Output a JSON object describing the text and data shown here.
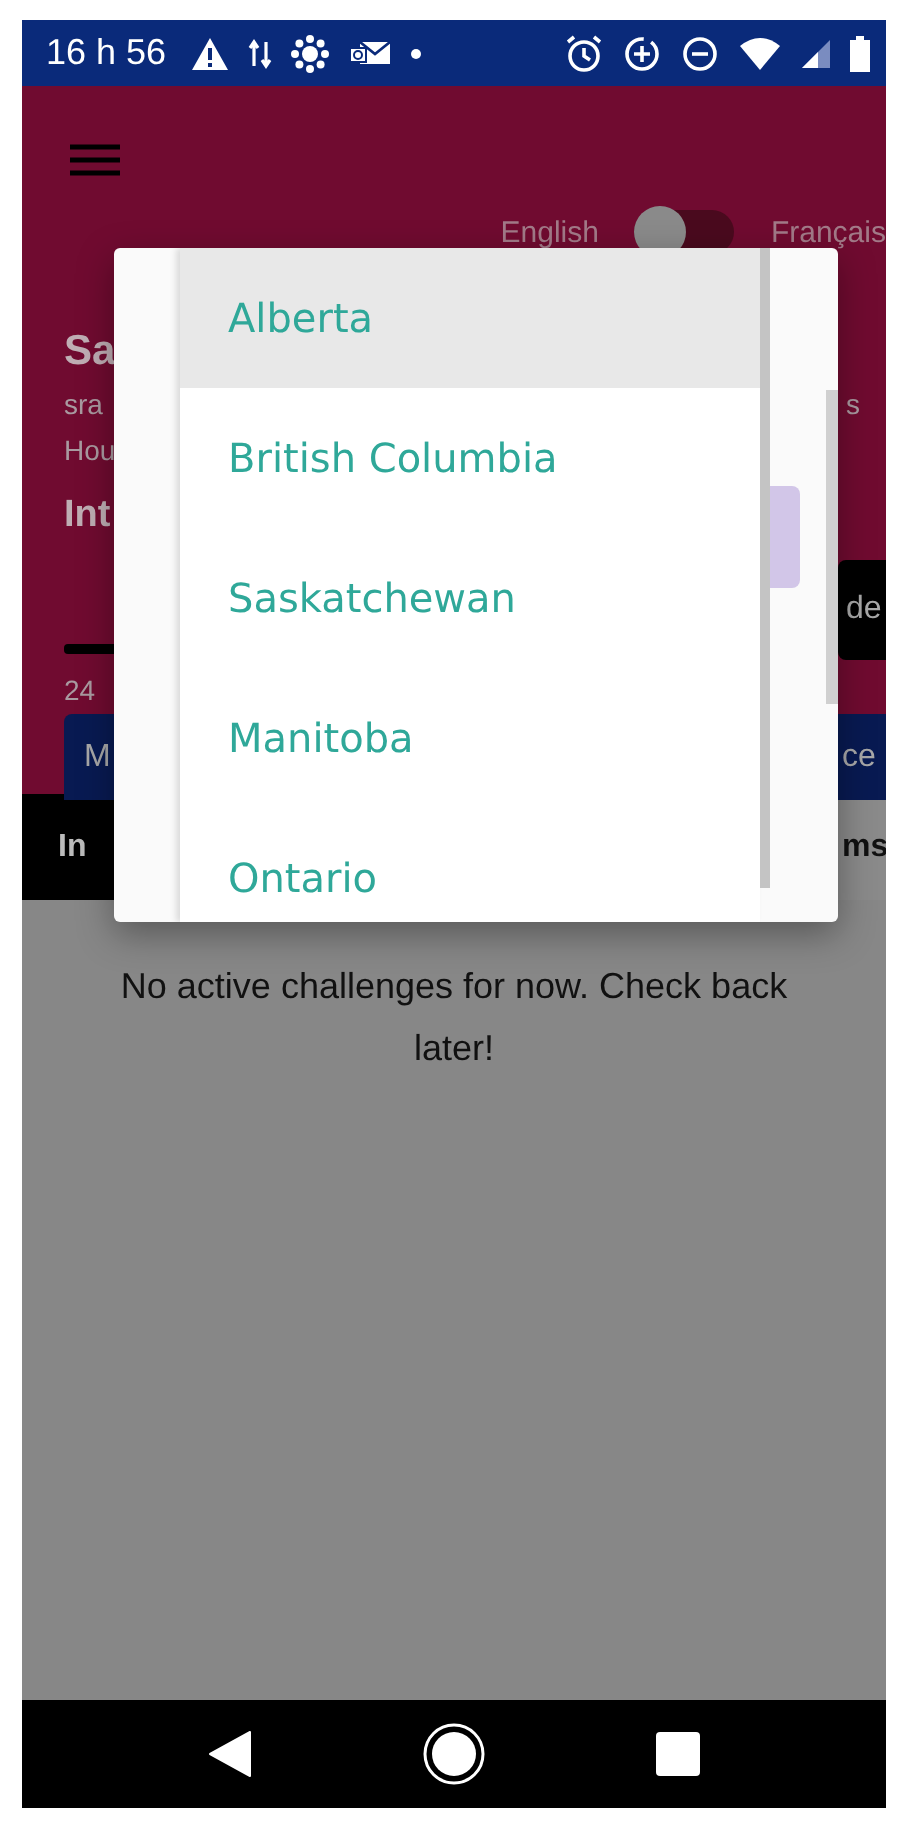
{
  "status_bar": {
    "time": "16 h 56"
  },
  "header": {
    "language_toggle": {
      "left_label": "English",
      "right_label": "Français",
      "on": false
    },
    "name": "Sa",
    "email": "sra",
    "email_right": "s",
    "line_3": "Hou",
    "heading": "Int",
    "action_button": "de",
    "count": "24",
    "left_button": "M",
    "right_button": "ce"
  },
  "tabs": [
    {
      "label": "In",
      "selected": true
    },
    {
      "label": "ms",
      "selected": false
    }
  ],
  "message": "No active challenges for now. Check back later!",
  "dropdown": {
    "items": [
      {
        "label": "Alberta",
        "selected": true
      },
      {
        "label": "British Columbia",
        "selected": false
      },
      {
        "label": "Saskatchewan",
        "selected": false
      },
      {
        "label": "Manitoba",
        "selected": false
      },
      {
        "label": "Ontario",
        "selected": false
      }
    ]
  }
}
